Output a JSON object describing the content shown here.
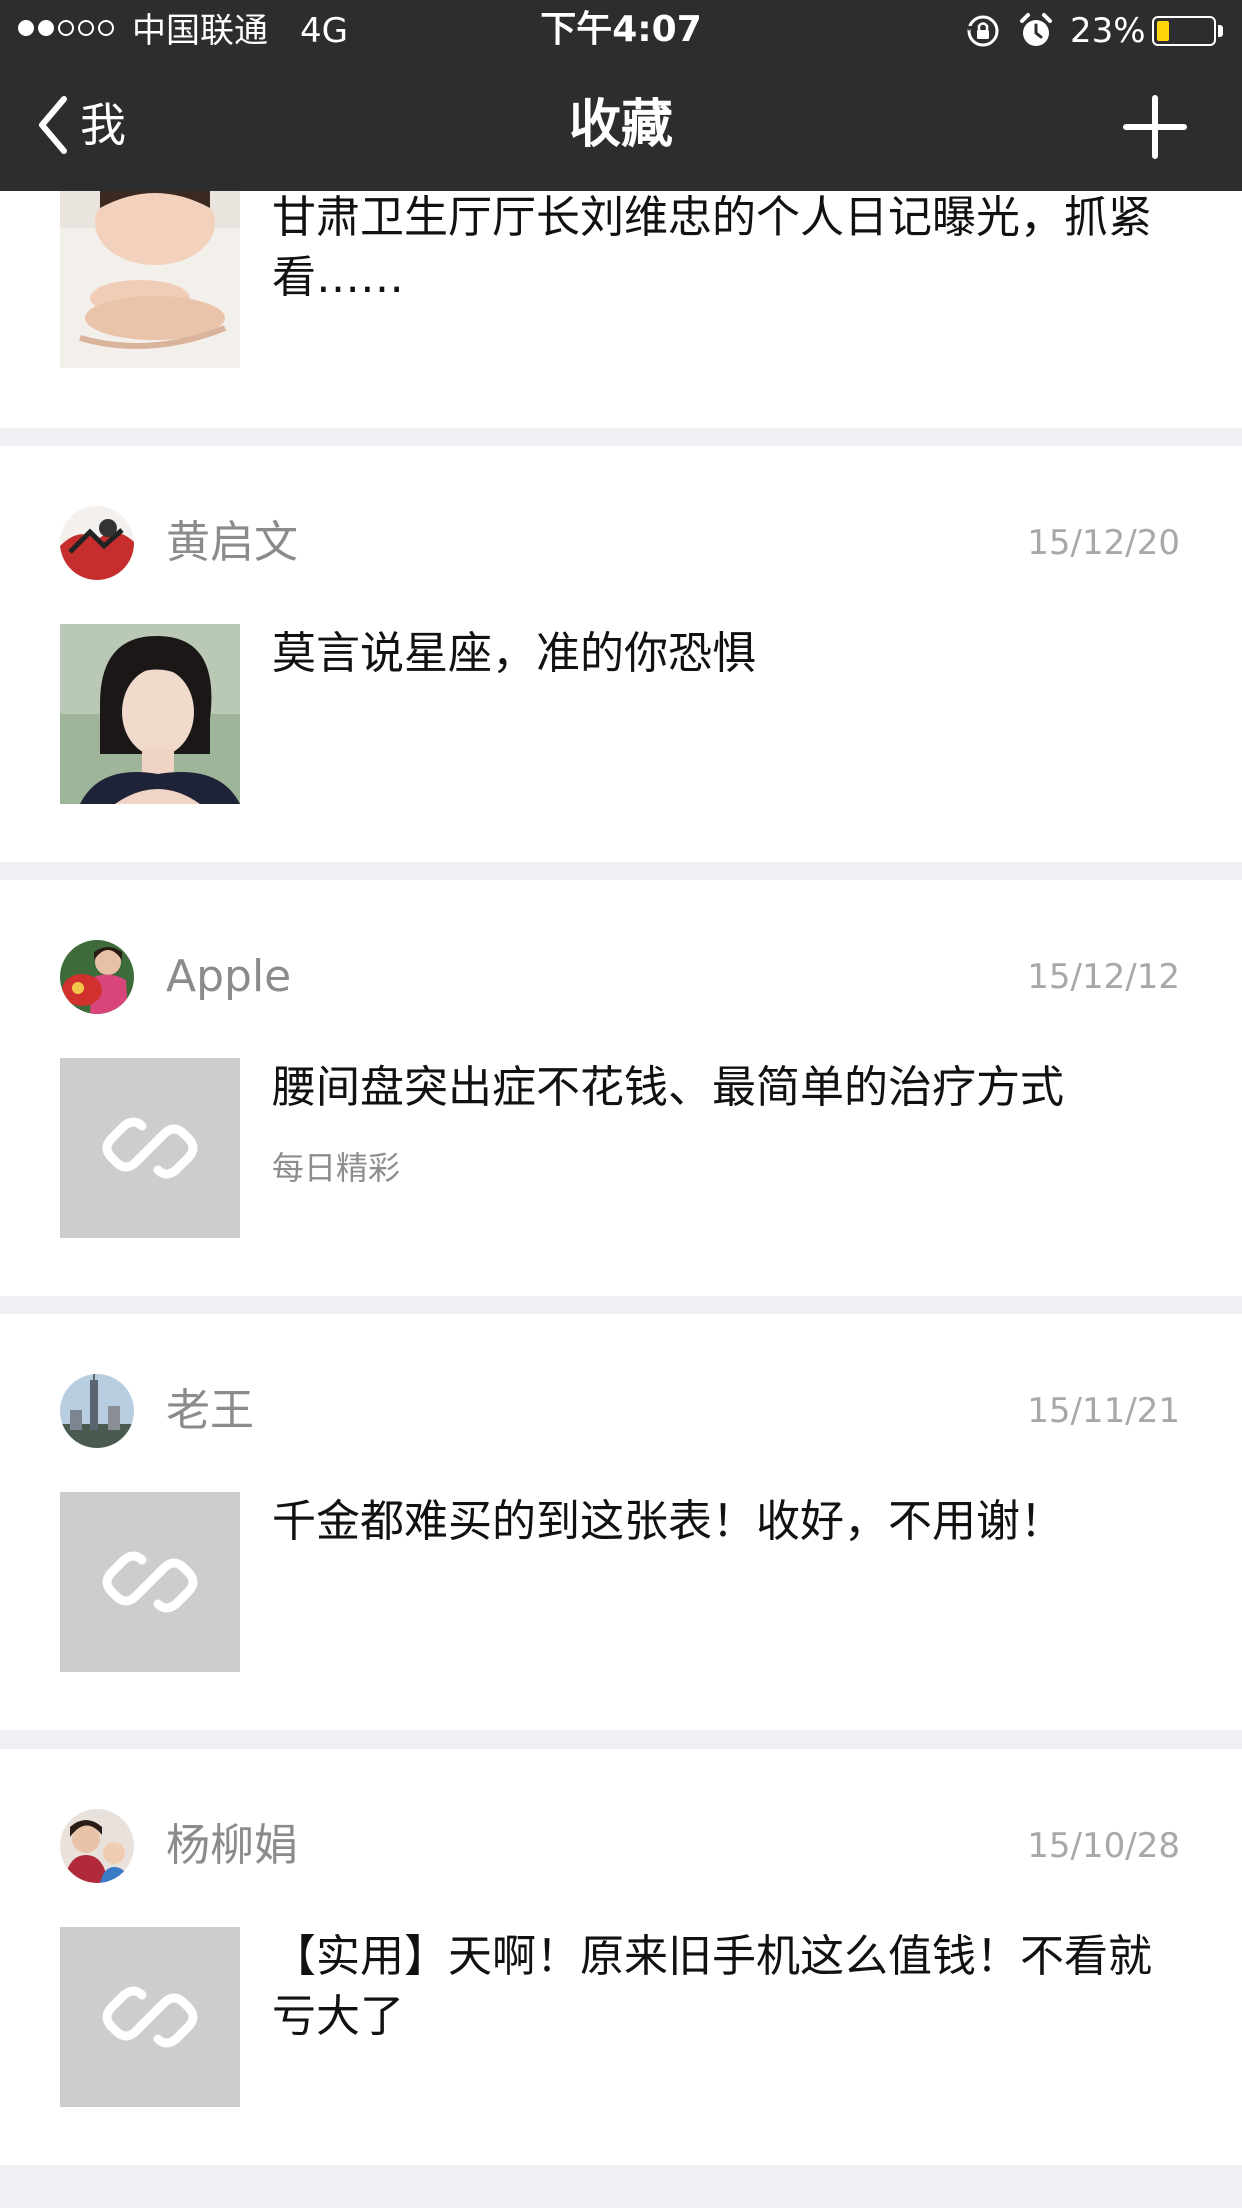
{
  "status_bar": {
    "carrier": "中国联通",
    "network": "4G",
    "time": "下午4:07",
    "battery_percent": "23%",
    "battery_level": 0.23,
    "signal_strength": 2,
    "icons": [
      "rotation-lock-icon",
      "alarm-icon"
    ]
  },
  "nav": {
    "back_label": "我",
    "title": "收藏",
    "add_icon": "plus-icon"
  },
  "favorites": [
    {
      "sender": "",
      "date": "",
      "title": "甘肃卫生厅厅长刘维忠的个人日记曝光，抓紧看……",
      "source": "",
      "thumbnail": "photo-washing-face"
    },
    {
      "sender": "黄启文",
      "date": "15/12/20",
      "title": "莫言说星座，准的你恐惧",
      "source": "",
      "thumbnail": "photo-girl"
    },
    {
      "sender": "Apple",
      "date": "15/12/12",
      "title": "腰间盘突出症不花钱、最简单的治疗方式",
      "source": "每日精彩",
      "thumbnail": "link-icon"
    },
    {
      "sender": "老王",
      "date": "15/11/21",
      "title": "千金都难买的到这张表！收好，不用谢！",
      "source": "",
      "thumbnail": "link-icon"
    },
    {
      "sender": "杨柳娟",
      "date": "15/10/28",
      "title": "【实用】天啊！原来旧手机这么值钱！不看就亏大了",
      "source": "",
      "thumbnail": "link-icon"
    }
  ],
  "colors": {
    "header_bg": "#2d2d2f",
    "page_bg": "#efeff4",
    "link_thumb_bg": "#cdcdcd",
    "battery": "#ffd60a"
  }
}
